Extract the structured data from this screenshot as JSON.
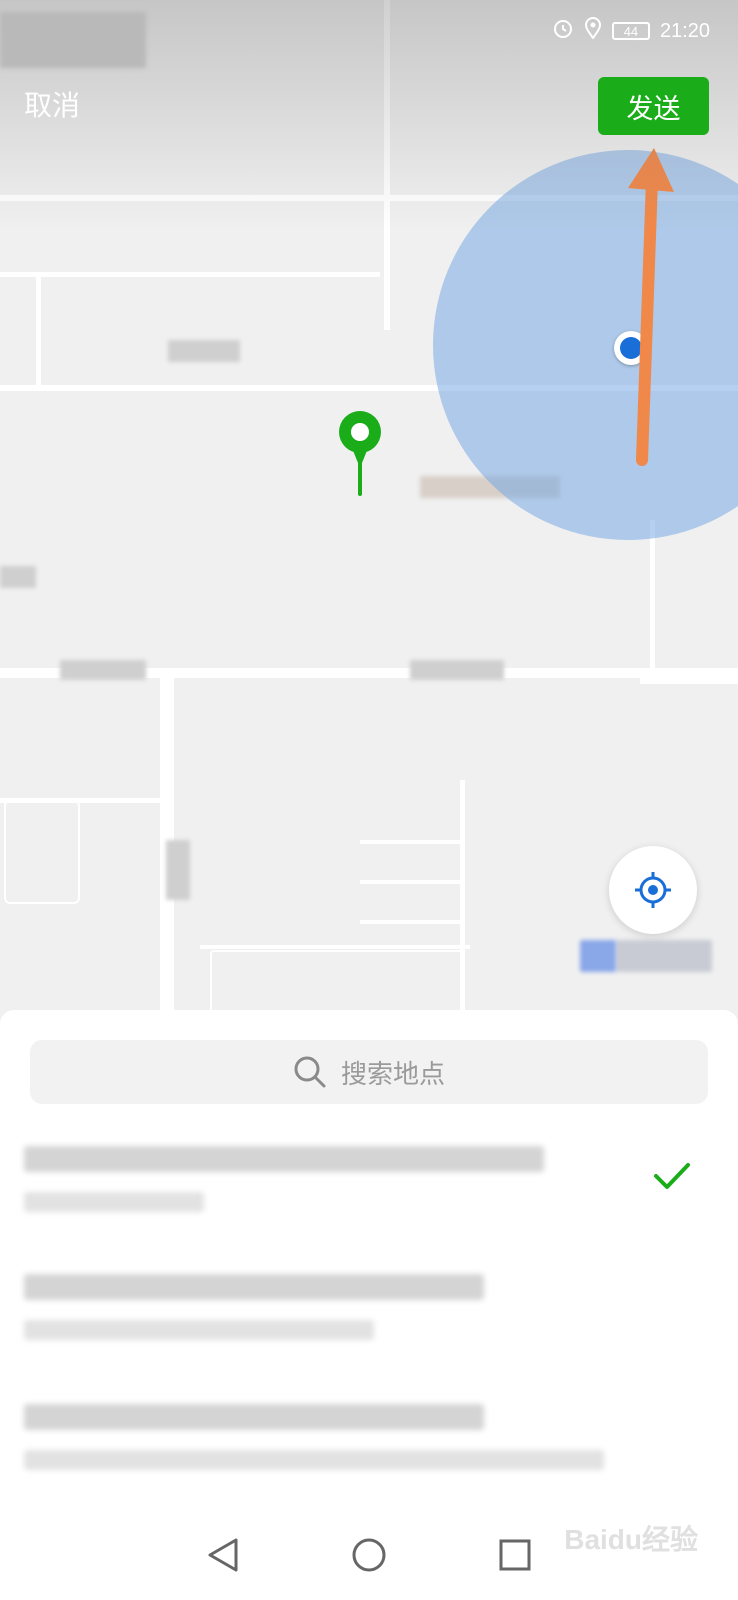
{
  "status_bar": {
    "time": "21:20",
    "battery": "44",
    "alarm_icon": "alarm-icon",
    "location_icon": "location-status-icon"
  },
  "header": {
    "cancel_label": "取消",
    "send_label": "发送"
  },
  "map": {
    "accent_color": "#1aad19",
    "range_color": "#7aaae4",
    "locate_icon": "crosshair-icon"
  },
  "bottom_sheet": {
    "search": {
      "placeholder": "搜索地点",
      "icon": "search-icon"
    },
    "selected_check_icon": "checkmark-icon"
  },
  "nav": {
    "back": "back-icon",
    "home": "home-icon",
    "recents": "recents-icon"
  },
  "watermark": {
    "text": "Baidu经验"
  }
}
